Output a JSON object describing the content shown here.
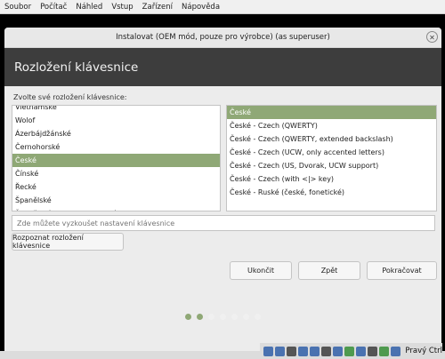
{
  "menubar": [
    "Soubor",
    "Počítač",
    "Náhled",
    "Vstup",
    "Zařízení",
    "Nápověda"
  ],
  "window_title": "Instalovat (OEM mód, pouze pro výrobce) (as superuser)",
  "header": "Rozložení klávesnice",
  "prompt": "Zvolte své rozložení klávesnice:",
  "layouts": [
    "Vietnamské",
    "Wolof",
    "Ázerbájdžánské",
    "Černohorské",
    "České",
    "Čínské",
    "Řecké",
    "Španělské",
    "Španělské (latinskoamerické)"
  ],
  "selected_layout": "České",
  "variants": [
    "České",
    "České - Czech (QWERTY)",
    "České - Czech (QWERTY, extended backslash)",
    "České - Czech (UCW, only accented letters)",
    "České - Czech (US, Dvorak, UCW support)",
    "České - Czech (with <|> key)",
    "České - Ruské (české, fonetické)"
  ],
  "selected_variant": "České",
  "test_placeholder": "Zde můžete vyzkoušet nastavení klávesnice",
  "detect_button": "Rozpoznat rozložení klávesnice",
  "buttons": {
    "quit": "Ukončit",
    "back": "Zpět",
    "next": "Pokračovat"
  },
  "progress": {
    "total": 7,
    "completed": 2
  },
  "tray_label": "Pravý Ctrl",
  "accent": "#8fa876"
}
